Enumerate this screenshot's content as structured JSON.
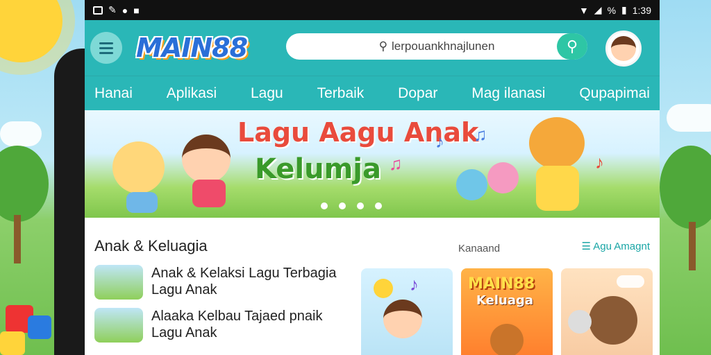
{
  "status_bar": {
    "time": "1:39",
    "battery_text": "%"
  },
  "header": {
    "logo_text": "MAIN88",
    "search": {
      "value": "lerpouankhnajlunen",
      "icon": "search-icon"
    }
  },
  "tabs": [
    {
      "label": "Hanai"
    },
    {
      "label": "Aplikasi"
    },
    {
      "label": "Lagu"
    },
    {
      "label": "Terbaik"
    },
    {
      "label": "Dopar"
    },
    {
      "label": "Mag ilanasi"
    },
    {
      "label": "Qupapimai"
    }
  ],
  "banner": {
    "line1": "Lagu Aagu Anak",
    "line2": "Kelumja",
    "slide_count": 4
  },
  "section": {
    "title": "Anak & Keluagia",
    "subtitle": "Kanaand",
    "link": "Agu Amagnt"
  },
  "list": [
    {
      "line1": "Anak & Kelaksi Lagu Terbagia",
      "line2": "Lagu Anak"
    },
    {
      "line1": "Alaaka Kelbau Tajaed pnaik",
      "line2": "Lagu Anak"
    }
  ],
  "cards": [
    {
      "title": ""
    },
    {
      "title": "MAIN88",
      "subtitle": "Keluaga"
    },
    {
      "title": ""
    }
  ],
  "colors": {
    "header": "#2ab7b7",
    "accent": "#d9f36a",
    "search_button": "#2ec6a5"
  }
}
